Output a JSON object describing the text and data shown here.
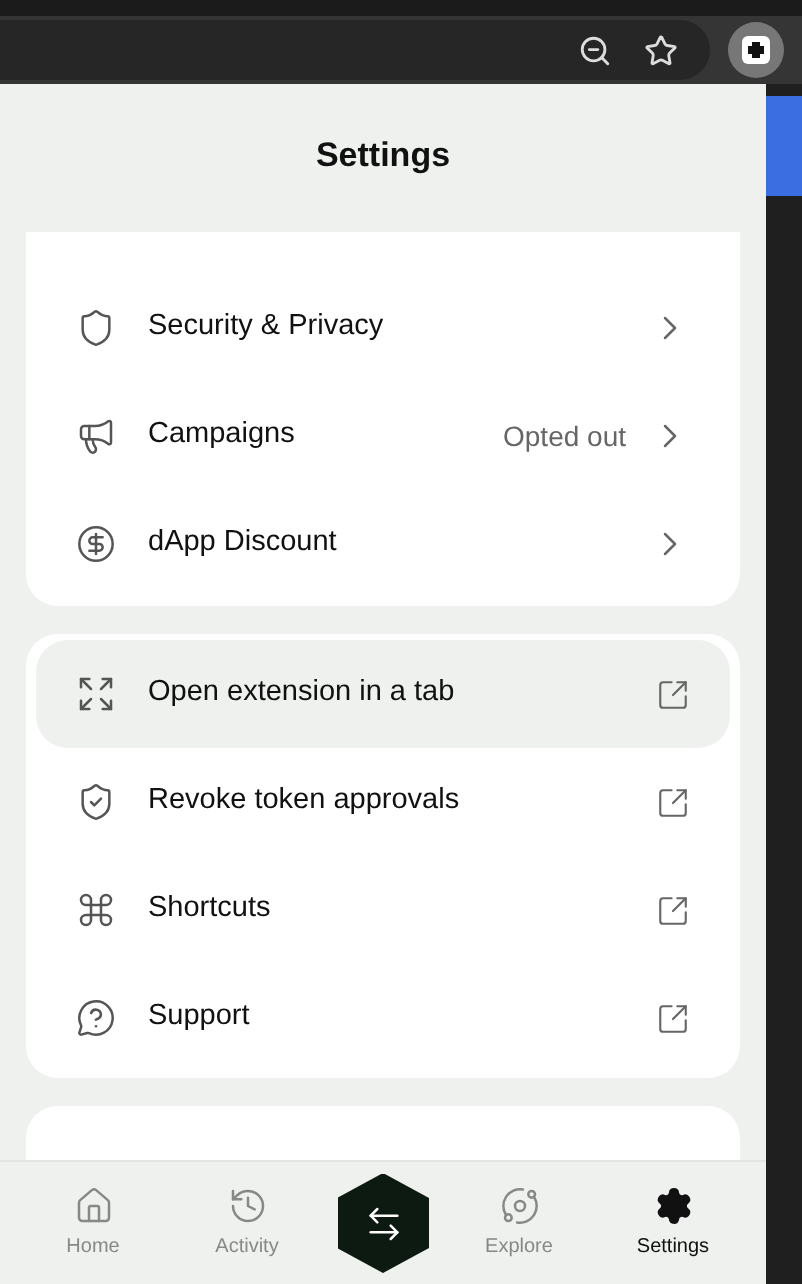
{
  "title": "Settings",
  "groups": [
    {
      "items": [
        {
          "label": "Security & Privacy",
          "kind": "chevron",
          "highlighted": false
        },
        {
          "label": "Campaigns",
          "kind": "chevron",
          "value": "Opted out",
          "highlighted": false
        },
        {
          "label": "dApp Discount",
          "kind": "chevron",
          "highlighted": false
        }
      ]
    },
    {
      "items": [
        {
          "label": "Open extension in a tab",
          "kind": "external",
          "highlighted": true
        },
        {
          "label": "Revoke token approvals",
          "kind": "external",
          "highlighted": false
        },
        {
          "label": "Shortcuts",
          "kind": "external",
          "highlighted": false
        },
        {
          "label": "Support",
          "kind": "external",
          "highlighted": false
        }
      ]
    }
  ],
  "nav": [
    {
      "label": "Home",
      "selected": false
    },
    {
      "label": "Activity",
      "selected": false
    },
    {
      "kind": "center"
    },
    {
      "label": "Explore",
      "selected": false
    },
    {
      "label": "Settings",
      "selected": true
    }
  ]
}
